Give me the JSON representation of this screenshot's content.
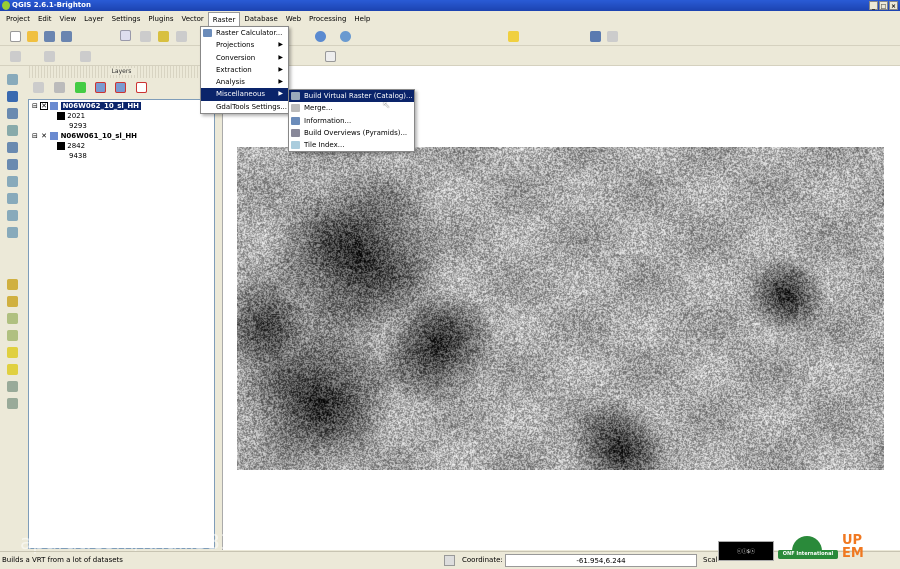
{
  "window": {
    "title": "QGIS 2.6.1-Brighton",
    "controls": [
      "_",
      "□",
      "×"
    ]
  },
  "menubar": [
    "Project",
    "Edit",
    "View",
    "Layer",
    "Settings",
    "Plugins",
    "Vector",
    "Raster",
    "Database",
    "Web",
    "Processing",
    "Help"
  ],
  "raster_menu": {
    "items": [
      {
        "label": "Raster Calculator...",
        "submenu": false
      },
      {
        "label": "Projections",
        "submenu": true
      },
      {
        "label": "Conversion",
        "submenu": true
      },
      {
        "label": "Extraction",
        "submenu": true
      },
      {
        "label": "Analysis",
        "submenu": true
      },
      {
        "label": "Miscellaneous",
        "submenu": true,
        "highlighted": true
      },
      {
        "label": "GdalTools Settings...",
        "submenu": false
      }
    ]
  },
  "misc_submenu": {
    "items": [
      "Build Virtual Raster (Catalog)...",
      "Merge...",
      "Information...",
      "Build Overviews (Pyramids)...",
      "Tile Index..."
    ]
  },
  "layers_panel": {
    "title": "Layers",
    "layers": [
      {
        "name": "N06W062_10_sl_HH",
        "selected": true,
        "min": "2021",
        "max": "9293"
      },
      {
        "name": "N06W061_10_sl_HH",
        "selected": false,
        "min": "2842",
        "max": "9438"
      }
    ]
  },
  "statusbar": {
    "message": "Builds a VRT from a lot of datasets",
    "coordinate_label": "Coordinate:",
    "coordinate_value": "-61.954,6.244",
    "scale_label": "Scal"
  },
  "logos": {
    "cc": "cc BY NC SA",
    "onf": "ONF International",
    "upem": "UPEM"
  },
  "watermark": "aparat.com/khalil333"
}
